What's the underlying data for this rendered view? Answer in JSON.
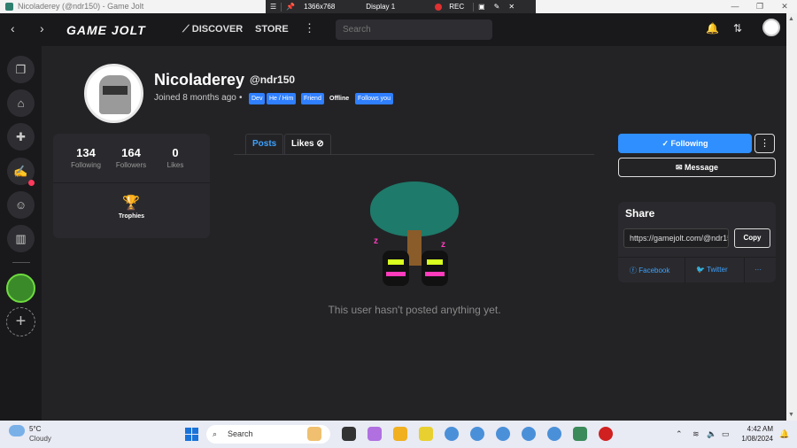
{
  "window": {
    "title": "Nicoladerey (@ndr150) - Game Jolt",
    "minimize": "—",
    "restore": "❐",
    "close": "✕"
  },
  "remote_bar": {
    "resolution": "1366x768",
    "display": "Display 1",
    "rec": "REC"
  },
  "nav": {
    "logo": "GAME JOLT",
    "discover": "DISCOVER",
    "store": "STORE",
    "search_placeholder": "Search"
  },
  "profile": {
    "name": "Nicoladerey",
    "handle": "@ndr150",
    "joined": "Joined 8 months ago",
    "tags": [
      "Dev",
      "He / Him",
      "Friend",
      "Offline",
      "Follows you"
    ]
  },
  "stats": [
    {
      "value": "134",
      "label": "Following"
    },
    {
      "value": "164",
      "label": "Followers"
    },
    {
      "value": "0",
      "label": "Likes"
    }
  ],
  "trophies_label": "Trophies",
  "tabs": [
    {
      "label": "Posts"
    },
    {
      "label": "Likes"
    }
  ],
  "empty_message": "This user hasn't posted anything yet.",
  "actions": {
    "following": "Following",
    "message": "Message"
  },
  "share": {
    "title": "Share",
    "url": "https://gamejolt.com/@ndr150",
    "copy": "Copy",
    "facebook": "Facebook",
    "twitter": "Twitter",
    "more": "···"
  },
  "taskbar": {
    "weather_temp": "5°C",
    "weather_cond": "Cloudy",
    "search": "Search",
    "time": "4:42 AM",
    "date": "1/08/2024"
  },
  "colors": {
    "accent": "#2f8fff",
    "link": "#3da2ff",
    "background": "#232326"
  }
}
